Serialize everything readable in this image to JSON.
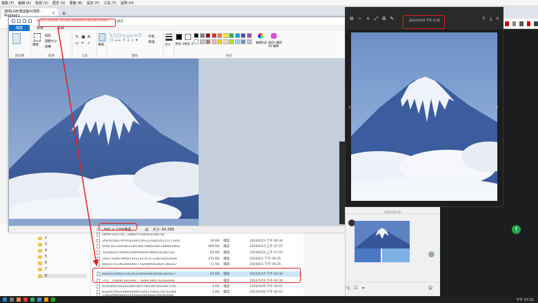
{
  "browser": {
    "menu": [
      "檔案 (F)",
      "編輯 (E)",
      "檢視 (V)",
      "歷史 (S)",
      "書籤 (B)",
      "設定 (P)",
      "工具 (T)",
      "說明 (H)"
    ],
    "tab_title": "請問LINE傳送圖片問題 - Mobile01",
    "new_tab": "+"
  },
  "paint": {
    "filename": "beac67ad06b7505e61509690093b58624ef8c7",
    "title_suffix": " - 小畫家",
    "tabs": [
      "檔案",
      "常用",
      "檢視"
    ],
    "groups": [
      "剪貼簿",
      "影像",
      "工具",
      "筆刷",
      "圖形",
      "色彩"
    ],
    "image_labels": [
      "選取",
      "裁剪",
      "調整大小",
      "旋轉"
    ],
    "brush_label": "筆刷",
    "shapes_labels": [
      "外框",
      "填滿"
    ],
    "size_label": "大小",
    "color_labels": [
      "色彩 1",
      "色彩 2",
      "編輯色彩",
      "使用小畫家 3D 編輯"
    ],
    "status_dimensions": "900 × 1200像素",
    "status_size": "大小: 64.2KB",
    "palette": [
      "#000000",
      "#7f7f7f",
      "#880015",
      "#ed1c24",
      "#ff7f27",
      "#fff200",
      "#22b14c",
      "#00a2e8",
      "#3f48cc",
      "#a349a4",
      "#ffffff",
      "#c3c3c3",
      "#b97a57",
      "#ffaec9",
      "#ffc90e",
      "#efe4b0",
      "#b5e61d",
      "#99d9ea",
      "#7092be",
      "#c8bfe7"
    ]
  },
  "viewer": {
    "date": "2024/5/19 下午 4:35",
    "prev": "‹",
    "next": "›"
  },
  "chat": {
    "date_label": "5月19日(日)"
  },
  "explorer": {
    "folders": [
      "2",
      "3",
      "4",
      "5",
      "6",
      "7",
      "8"
    ],
    "files": [
      {
        "name": "c6ff9c5e2f7cb...5f8b2f7c18ed1419b7aa",
        "size": "",
        "type": "",
        "date": ""
      },
      {
        "name": "3f41605b979cfe5b24d1cde3124805d5c1c1735d2",
        "size": "16 KB",
        "type": "檔案",
        "date": "2024/6/23 下午 06:34"
      },
      {
        "name": "4deb acc350adb1590cdb679bbcae6c16b9b5d46c",
        "size": "806 KB",
        "type": "檔案",
        "date": "2024/6/23 上午 07:25"
      },
      {
        "name": "19246d2d76040cc690f46859199641f43b11a2",
        "size": "60 KB",
        "type": "檔案",
        "date": "2024/6/23 上午 07:25"
      },
      {
        "name": "19e271b04799567b422187b747236e2bd18409",
        "size": "270 KB",
        "type": "檔案",
        "date": "2024/6/1 下午 09:35"
      },
      {
        "name": "9a0557a13f6cb0b0f4c7782989f5b3834 2b83a7",
        "size": "11 KB",
        "type": "檔案",
        "date": "2024/6/1 下午 09:35"
      },
      {
        "name": "beac67ad06b7505e61509690093b58624ef8c7",
        "size": "65 KB",
        "type": "檔案",
        "date": "2024/5/19 下午 04:36"
      },
      {
        "name": "7f1c...1d6b81a4ce49c...7bd9c30b576c0826da",
        "size": "",
        "type": "檔案",
        "date": "2024/5/19 下午 04:36"
      },
      {
        "name": "4cdedfd10e92e028b74bf5784cd67ba1e607c92",
        "size": "3 KB",
        "type": "檔案",
        "date": "2024/4/29 下午 04:41"
      },
      {
        "name": "81a20cdf924d8e0e698193fd2704ac2567a1de4",
        "size": "3 KB",
        "type": "檔案",
        "date": "2024/4/29 下午 04:41"
      },
      {
        "name": "53baa4f6f6b64c61a4a0e260a9a629f0365b6e",
        "size": "",
        "type": "",
        "date": ""
      }
    ]
  },
  "taskbar": {
    "clock": "下午 07:51"
  }
}
